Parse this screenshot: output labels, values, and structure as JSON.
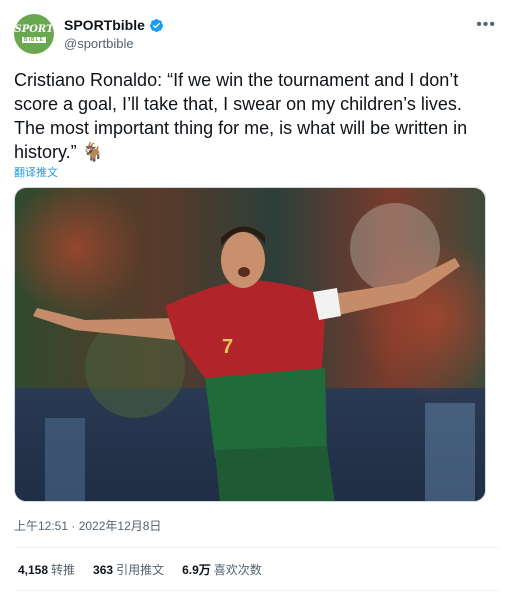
{
  "account": {
    "name": "SPORTbible",
    "handle": "@sportbible",
    "avatar_top": "SPORT",
    "avatar_bottom": "BIBLE"
  },
  "tweet": {
    "text": "Cristiano Ronaldo: “If we win the tournament and I don’t score a goal, I’ll take that, I swear on my children’s lives. The most important thing for me, is what will be written in history.” 🐐",
    "translate_label": "翻译推文",
    "timestamp": "上午12:51 · 2022年12月8日"
  },
  "stats": {
    "retweets_count": "4,158",
    "retweets_label": "转推",
    "quotes_count": "363",
    "quotes_label": "引用推文",
    "likes_count": "6.9万",
    "likes_label": "喜欢次数"
  },
  "colors": {
    "accent": "#1d9bf0",
    "muted": "#536471",
    "avatar_bg": "#6aa84f"
  },
  "icons": {
    "verified": "verified-badge-icon",
    "more": "more-options-icon"
  }
}
